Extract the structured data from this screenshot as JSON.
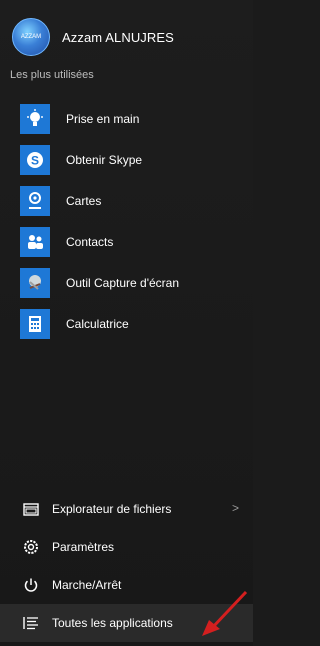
{
  "user": {
    "avatar_text": "AZZAM",
    "name": "Azzam ALNUJRES"
  },
  "most_used_label": "Les plus utilisées",
  "apps": [
    {
      "label": "Prise en main",
      "icon": "lightbulb-icon"
    },
    {
      "label": "Obtenir Skype",
      "icon": "skype-icon"
    },
    {
      "label": "Cartes",
      "icon": "maps-icon"
    },
    {
      "label": "Contacts",
      "icon": "contacts-icon"
    },
    {
      "label": "Outil Capture d'écran",
      "icon": "snipping-tool-icon"
    },
    {
      "label": "Calculatrice",
      "icon": "calculator-icon"
    }
  ],
  "bottom": {
    "explorer": "Explorateur de fichiers",
    "explorer_chevron": ">",
    "settings": "Paramètres",
    "power": "Marche/Arrêt",
    "all_apps": "Toutes les applications"
  },
  "colors": {
    "tile": "#1e78d6",
    "background": "#1b1b1b",
    "annotation_arrow": "#d41f1f"
  }
}
